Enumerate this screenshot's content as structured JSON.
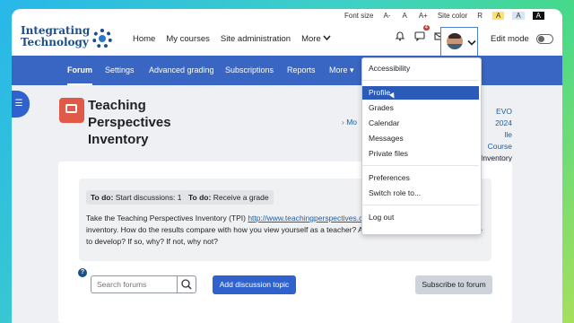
{
  "fontbar": {
    "label": "Font size",
    "sizes": [
      "A-",
      "A",
      "A+"
    ],
    "color_label": "Site color",
    "colors": [
      "R",
      "A",
      "A",
      "A"
    ]
  },
  "logo": {
    "line1": "Integrating",
    "line2": "Technology"
  },
  "topnav": [
    "Home",
    "My courses",
    "Site administration",
    "More"
  ],
  "notifications": {
    "badge": "4"
  },
  "editmode": {
    "label": "Edit mode"
  },
  "subnav": [
    "Forum",
    "Settings",
    "Advanced grading",
    "Subscriptions",
    "Reports",
    "More"
  ],
  "page": {
    "title": "Teaching Perspectives Inventory",
    "breadcrumb_partial": "Mo",
    "breadcrumb_right": [
      "EVO 2024",
      "lle Course",
      "Inventory"
    ]
  },
  "todo": [
    {
      "label": "To do:",
      "value": "Start discussions: 1"
    },
    {
      "label": "To do:",
      "value": "Receive a grade"
    }
  ],
  "description": {
    "before_link": "Take the Teaching Perspectives Inventory (TPI) ",
    "link": "http://www.teachingperspectives.co",
    "after_link": "inventory. How do the results compare with how you view yourself as a teacher? Are there any perspectives you'd like to develop? If so, why? If not, why not?"
  },
  "search": {
    "placeholder": "Search forums"
  },
  "buttons": {
    "add_topic": "Add discussion topic",
    "subscribe": "Subscribe to forum"
  },
  "user_menu": {
    "items": [
      "Accessibility",
      "Profile",
      "Grades",
      "Calendar",
      "Messages",
      "Private files",
      "Preferences",
      "Switch role to...",
      "Log out"
    ],
    "active": "Profile"
  },
  "colors": {
    "brand_blue": "#3866c2",
    "primary_button": "#2f62cd",
    "active_menu": "#2a5bb8"
  }
}
